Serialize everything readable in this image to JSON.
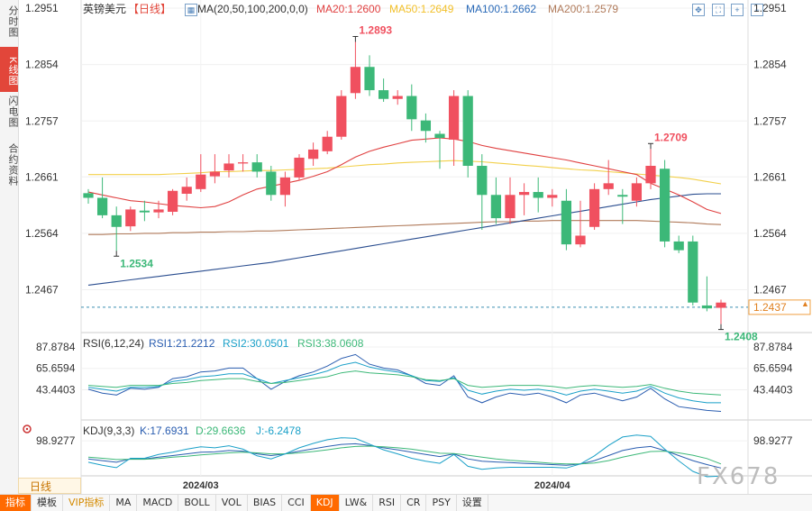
{
  "left_tabs": [
    "分时图",
    "K线图",
    "闪电图",
    "合约资料"
  ],
  "active_left_tab": "K线图",
  "legend": {
    "symbol": "英镑美元",
    "period_tag": "【日线】",
    "ma_params": "MA(20,50,100,200,0,0)",
    "ma20": "MA20:1.2600",
    "ma50": "MA50:1.2649",
    "ma100": "MA100:1.2662",
    "ma200": "MA200:1.2579"
  },
  "rsi_legend": {
    "title": "RSI(6,12,24)",
    "rsi1": "RSI1:21.2212",
    "rsi2": "RSI2:30.0501",
    "rsi3": "RSI3:38.0608"
  },
  "kdj_legend": {
    "title": "KDJ(9,3,3)",
    "k": "K:17.6931",
    "d": "D:29.6636",
    "j": "J:-6.2478"
  },
  "period_button": "日线",
  "bottom_tabs": [
    "指标",
    "模板",
    "VIP指标",
    "MA",
    "MACD",
    "BOLL",
    "VOL",
    "BIAS",
    "CCI",
    "KDJ",
    "LW&",
    "RSI",
    "CR",
    "PSY",
    "设置"
  ],
  "active_bottom_tab": "KDJ",
  "watermark": "FX678",
  "colors": {
    "up": "#f0505f",
    "down": "#3cb878",
    "ma20": "#e04040",
    "ma50": "#f2d04a",
    "ma100": "#2a4d8f",
    "ma200": "#b07a5a",
    "rsi1": "#2a5db0",
    "rsi2": "#1aa0c8",
    "rsi3": "#3cb878"
  },
  "chart_data": [
    {
      "type": "candlestick",
      "title": "英镑美元 日线",
      "y_ticks": [
        "1.2951",
        "1.2854",
        "1.2757",
        "1.2661",
        "1.2564",
        "1.2467"
      ],
      "ylim": [
        1.2395,
        1.2965
      ],
      "x_tick_labels": [
        "2024/03",
        "2024/04"
      ],
      "last_price": "1.2437",
      "annotations": {
        "high": "1.2893",
        "low1": "1.2534",
        "high2": "1.2709",
        "low2": "1.2408"
      },
      "candles": [
        [
          1.2633,
          1.2625,
          1.264,
          1.2615
        ],
        [
          1.2625,
          1.2595,
          1.266,
          1.259
        ],
        [
          1.2595,
          1.2575,
          1.261,
          1.2534
        ],
        [
          1.2576,
          1.2605,
          1.261,
          1.2568
        ],
        [
          1.2603,
          1.26,
          1.262,
          1.2585
        ],
        [
          1.26,
          1.2605,
          1.262,
          1.259
        ],
        [
          1.2601,
          1.2637,
          1.264,
          1.2595
        ],
        [
          1.2632,
          1.2644,
          1.266,
          1.262
        ],
        [
          1.264,
          1.2665,
          1.27,
          1.2635
        ],
        [
          1.2662,
          1.267,
          1.27,
          1.265
        ],
        [
          1.2672,
          1.2684,
          1.27,
          1.266
        ],
        [
          1.2684,
          1.2686,
          1.27,
          1.267
        ],
        [
          1.2686,
          1.267,
          1.27,
          1.266
        ],
        [
          1.267,
          1.263,
          1.268,
          1.262
        ],
        [
          1.263,
          1.266,
          1.267,
          1.261
        ],
        [
          1.266,
          1.2694,
          1.27,
          1.2655
        ],
        [
          1.2692,
          1.2708,
          1.272,
          1.268
        ],
        [
          1.2705,
          1.273,
          1.274,
          1.27
        ],
        [
          1.273,
          1.28,
          1.281,
          1.2725
        ],
        [
          1.2805,
          1.285,
          1.2893,
          1.2795
        ],
        [
          1.285,
          1.281,
          1.287,
          1.28
        ],
        [
          1.281,
          1.2795,
          1.283,
          1.279
        ],
        [
          1.2795,
          1.28,
          1.281,
          1.2785
        ],
        [
          1.28,
          1.276,
          1.282,
          1.274
        ],
        [
          1.2758,
          1.274,
          1.277,
          1.272
        ],
        [
          1.2735,
          1.2728,
          1.274,
          1.2675
        ],
        [
          1.2725,
          1.28,
          1.281,
          1.268
        ],
        [
          1.28,
          1.268,
          1.281,
          1.266
        ],
        [
          1.268,
          1.263,
          1.27,
          1.257
        ],
        [
          1.263,
          1.259,
          1.266,
          1.258
        ],
        [
          1.259,
          1.263,
          1.266,
          1.258
        ],
        [
          1.263,
          1.2635,
          1.265,
          1.2595
        ],
        [
          1.2635,
          1.2625,
          1.266,
          1.26
        ],
        [
          1.2625,
          1.263,
          1.264,
          1.261
        ],
        [
          1.262,
          1.2545,
          1.264,
          1.2535
        ],
        [
          1.2545,
          1.256,
          1.262,
          1.254
        ],
        [
          1.2575,
          1.264,
          1.265,
          1.257
        ],
        [
          1.264,
          1.265,
          1.269,
          1.263
        ],
        [
          1.263,
          1.2627,
          1.264,
          1.258
        ],
        [
          1.262,
          1.265,
          1.266,
          1.261
        ],
        [
          1.265,
          1.268,
          1.2709,
          1.264
        ],
        [
          1.2675,
          1.255,
          1.269,
          1.254
        ],
        [
          1.255,
          1.2535,
          1.256,
          1.253
        ],
        [
          1.255,
          1.2445,
          1.256,
          1.244
        ],
        [
          1.244,
          1.2435,
          1.249,
          1.243
        ],
        [
          1.2436,
          1.2445,
          1.245,
          1.2408
        ]
      ],
      "ma20": [
        1.2635,
        1.263,
        1.2625,
        1.262,
        1.2618,
        1.2615,
        1.2612,
        1.261,
        1.2608,
        1.261,
        1.2618,
        1.263,
        1.264,
        1.2645,
        1.265,
        1.2655,
        1.2662,
        1.267,
        1.2682,
        1.2695,
        1.2705,
        1.2712,
        1.2718,
        1.2724,
        1.2726,
        1.2728,
        1.2726,
        1.2722,
        1.2715,
        1.271,
        1.2706,
        1.2702,
        1.2698,
        1.2694,
        1.269,
        1.2685,
        1.268,
        1.2675,
        1.267,
        1.2665,
        1.265,
        1.264,
        1.263,
        1.2618,
        1.2605,
        1.2598
      ],
      "ma50": [
        1.2665,
        1.2665,
        1.2665,
        1.2665,
        1.2665,
        1.2665,
        1.2666,
        1.2667,
        1.2668,
        1.267,
        1.267,
        1.2671,
        1.2672,
        1.2672,
        1.2673,
        1.2674,
        1.2675,
        1.2676,
        1.2678,
        1.268,
        1.2682,
        1.2683,
        1.2685,
        1.2686,
        1.2687,
        1.2688,
        1.2689,
        1.2688,
        1.2687,
        1.2685,
        1.2683,
        1.2681,
        1.2679,
        1.2677,
        1.2675,
        1.2673,
        1.2672,
        1.267,
        1.2668,
        1.2666,
        1.2664,
        1.2662,
        1.266,
        1.2657,
        1.2653,
        1.2649
      ],
      "ma100": [
        1.2475,
        1.2478,
        1.2481,
        1.2484,
        1.2487,
        1.249,
        1.2493,
        1.2496,
        1.2499,
        1.2502,
        1.2505,
        1.2508,
        1.2511,
        1.2514,
        1.2518,
        1.2522,
        1.2526,
        1.253,
        1.2534,
        1.2538,
        1.2542,
        1.2546,
        1.255,
        1.2554,
        1.2558,
        1.2562,
        1.2566,
        1.257,
        1.2574,
        1.2578,
        1.2582,
        1.2586,
        1.259,
        1.2594,
        1.2598,
        1.2602,
        1.2606,
        1.261,
        1.2614,
        1.2618,
        1.2622,
        1.2625,
        1.2628,
        1.2631,
        1.2632,
        1.2632
      ],
      "ma200": [
        1.2562,
        1.2562,
        1.2563,
        1.2563,
        1.2564,
        1.2564,
        1.2565,
        1.2565,
        1.2566,
        1.2566,
        1.2567,
        1.2567,
        1.2568,
        1.2568,
        1.2569,
        1.257,
        1.2571,
        1.2572,
        1.2573,
        1.2574,
        1.2575,
        1.2576,
        1.2577,
        1.2578,
        1.2579,
        1.258,
        1.2581,
        1.2582,
        1.2583,
        1.2584,
        1.2584,
        1.2585,
        1.2585,
        1.2586,
        1.2586,
        1.2586,
        1.2586,
        1.2586,
        1.2586,
        1.2586,
        1.2585,
        1.2584,
        1.2583,
        1.2582,
        1.258,
        1.2579
      ]
    },
    {
      "type": "line",
      "title": "RSI(6,12,24)",
      "y_ticks": [
        "87.8784",
        "65.6594",
        "43.4403"
      ],
      "ylim": [
        14,
        100
      ],
      "series": [
        {
          "name": "RSI1",
          "values": [
            44,
            40,
            38,
            45,
            44,
            46,
            55,
            57,
            62,
            63,
            66,
            66,
            55,
            44,
            52,
            58,
            62,
            68,
            76,
            80,
            70,
            66,
            64,
            58,
            50,
            48,
            58,
            36,
            30,
            36,
            40,
            38,
            40,
            36,
            30,
            38,
            40,
            36,
            32,
            36,
            45,
            34,
            26,
            24,
            22,
            21
          ]
        },
        {
          "name": "RSI2",
          "values": [
            46,
            44,
            42,
            46,
            46,
            47,
            52,
            54,
            57,
            58,
            60,
            60,
            55,
            50,
            53,
            56,
            59,
            63,
            69,
            72,
            67,
            64,
            62,
            58,
            53,
            52,
            56,
            43,
            39,
            42,
            44,
            43,
            44,
            42,
            38,
            42,
            44,
            42,
            40,
            42,
            47,
            40,
            35,
            32,
            30,
            30
          ]
        },
        {
          "name": "RSI3",
          "values": [
            48,
            47,
            46,
            48,
            48,
            48,
            50,
            51,
            53,
            54,
            55,
            55,
            52,
            50,
            51,
            53,
            55,
            57,
            61,
            63,
            61,
            60,
            59,
            57,
            54,
            53,
            55,
            48,
            46,
            47,
            48,
            48,
            48,
            47,
            45,
            47,
            48,
            47,
            46,
            47,
            49,
            45,
            42,
            40,
            39,
            38
          ]
        }
      ]
    },
    {
      "type": "line",
      "title": "KDJ(9,3,3)",
      "y_ticks": [
        "98.9277"
      ],
      "ylim": [
        0,
        150
      ],
      "series": [
        {
          "name": "K",
          "values": [
            45,
            40,
            35,
            45,
            45,
            50,
            55,
            60,
            65,
            66,
            70,
            68,
            60,
            55,
            60,
            68,
            75,
            82,
            88,
            90,
            85,
            78,
            72,
            65,
            58,
            52,
            60,
            45,
            38,
            36,
            34,
            32,
            30,
            28,
            26,
            30,
            40,
            55,
            70,
            78,
            82,
            70,
            55,
            40,
            28,
            18
          ]
        },
        {
          "name": "D",
          "values": [
            50,
            47,
            43,
            44,
            44,
            46,
            50,
            53,
            57,
            60,
            63,
            65,
            63,
            60,
            60,
            63,
            67,
            72,
            78,
            82,
            83,
            81,
            78,
            74,
            68,
            62,
            61,
            56,
            50,
            45,
            41,
            38,
            35,
            32,
            30,
            30,
            33,
            40,
            50,
            59,
            67,
            68,
            63,
            56,
            46,
            30
          ]
        },
        {
          "name": "J",
          "values": [
            35,
            26,
            19,
            47,
            47,
            58,
            65,
            74,
            81,
            78,
            84,
            74,
            54,
            45,
            60,
            78,
            91,
            102,
            108,
            106,
            89,
            72,
            60,
            47,
            38,
            32,
            58,
            23,
            14,
            18,
            20,
            20,
            20,
            20,
            18,
            30,
            54,
            85,
            110,
            116,
            112,
            74,
            39,
            8,
            -8,
            -6
          ]
        }
      ]
    }
  ]
}
